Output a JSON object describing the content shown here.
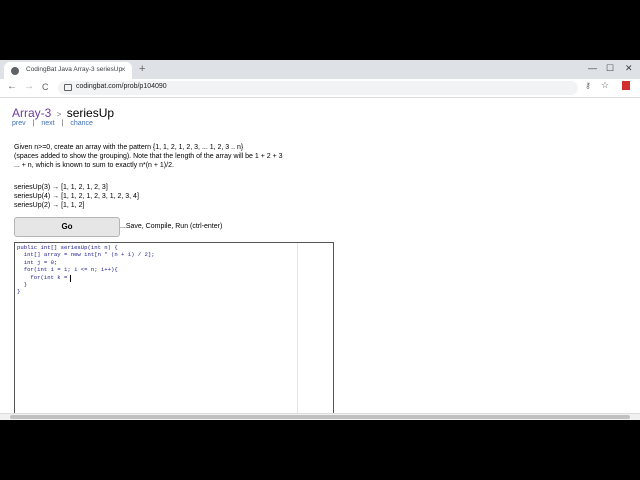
{
  "browser": {
    "tab_title": "CodingBat Java Array-3 seriesUp",
    "tab_close": "×",
    "new_tab": "+",
    "minimize": "—",
    "maximize": "☐",
    "close": "✕",
    "back": "←",
    "forward": "→",
    "reload": "C",
    "url": "codingbat.com/prob/p104090",
    "key_icon": "⚷",
    "star_icon": "☆"
  },
  "page": {
    "section": "Array-3",
    "separator": ">",
    "problem": "seriesUp",
    "nav": {
      "prev": "prev",
      "next": "next",
      "chance": "chance",
      "divider": "|"
    },
    "description_1": "Given n>=0, create an array with the pattern {1,    1, 2,    1, 2, 3,   ... 1, 2, 3 .. n}",
    "description_2": "(spaces added to show the grouping). Note that the length of the array will be 1 + 2 + 3",
    "description_3": "... + n, which is known to sum to exactly n*(n + 1)/2.",
    "examples": [
      "seriesUp(3) → [1, 1, 2, 1, 2, 3]",
      "seriesUp(4) → [1, 1, 2, 1, 2, 3, 1, 2, 3, 4]",
      "seriesUp(2) → [1, 1, 2]"
    ],
    "go_label": "Go",
    "go_hint": "...Save, Compile, Run (ctrl-enter)",
    "code_lines": [
      "public int[] seriesUp(int n) {",
      "  int[] array = new int[n * (n + 1) / 2];",
      "  int j = 0;",
      "  for(int i = 1; i <= n; i++){",
      "    for(int k = ",
      "  }",
      "}"
    ]
  }
}
